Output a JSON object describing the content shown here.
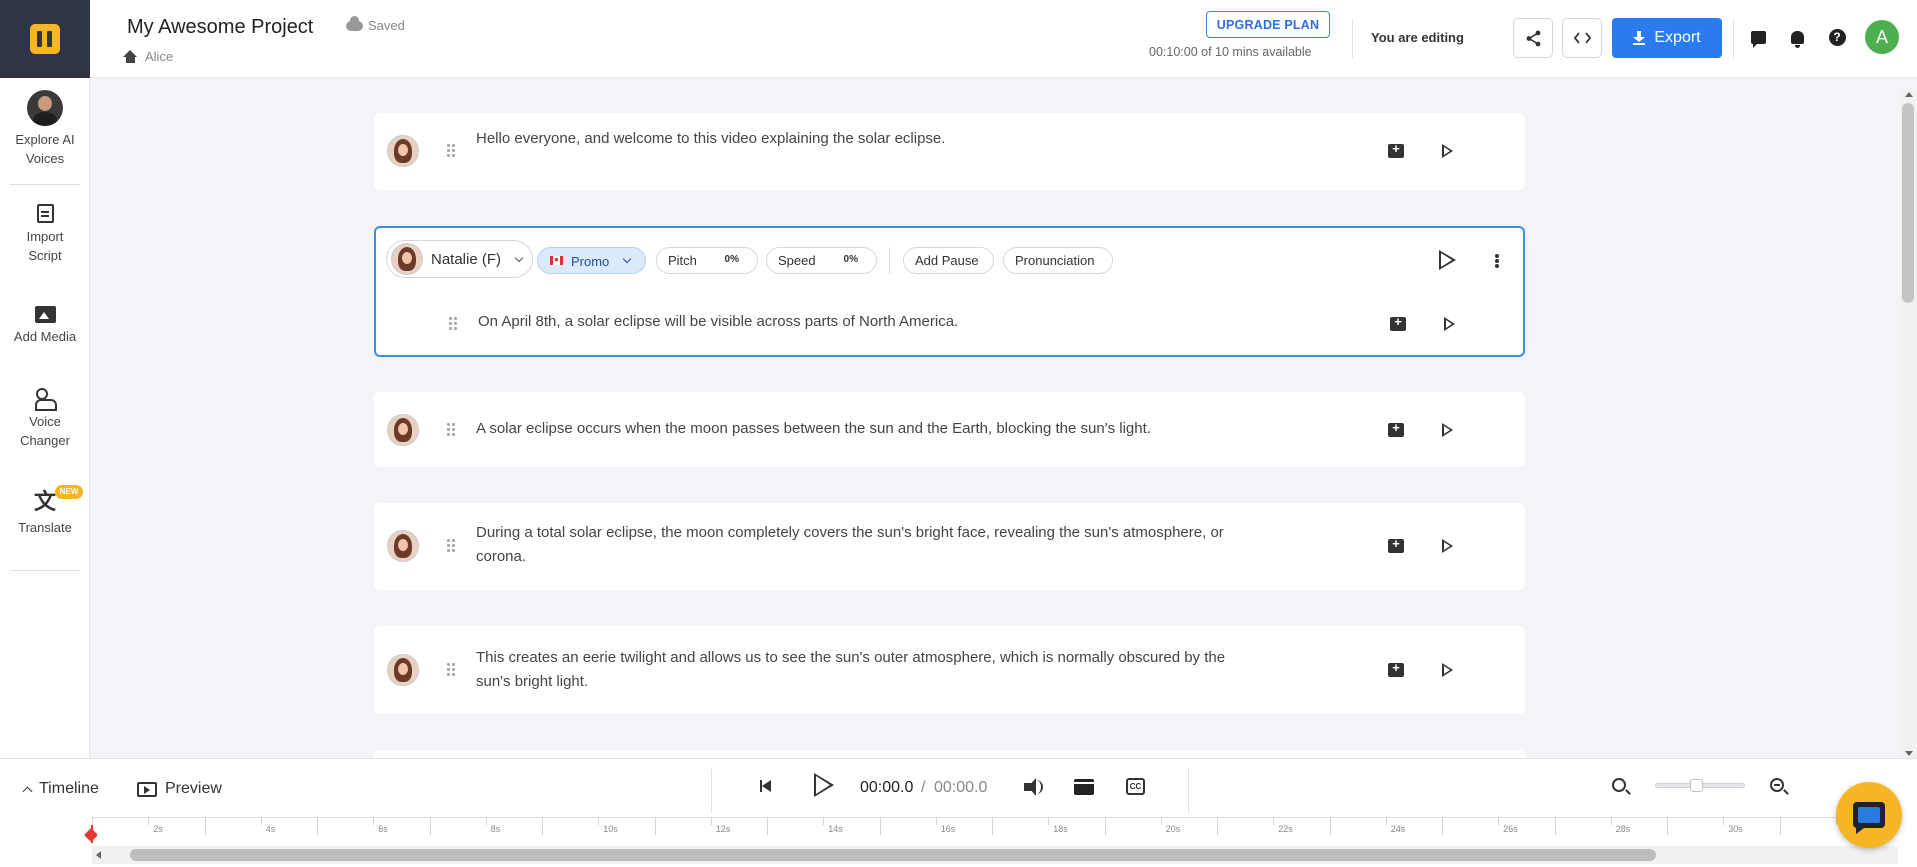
{
  "header": {
    "project_title": "My Awesome Project",
    "save_status": "Saved",
    "breadcrumb_user": "Alice",
    "upgrade_label": "UPGRADE PLAN",
    "minutes_available": "00:10:00 of 10 mins available",
    "editing_status": "You are editing",
    "export_label": "Export",
    "user_initial": "A",
    "user_avatar_color": "#4caf50",
    "accent_color": "#2b7bf0",
    "icons": [
      "share-icon",
      "embed-code-icon",
      "download-icon",
      "chat-icon",
      "bell-icon",
      "help-icon"
    ]
  },
  "sidebar": {
    "items": [
      {
        "label_line1": "Explore AI",
        "label_line2": "Voices",
        "icon": "voice-avatar-icon"
      },
      {
        "label_line1": "Import",
        "label_line2": "Script",
        "icon": "import-script-icon"
      },
      {
        "label_line1": "Add Media",
        "label_line2": "",
        "icon": "media-icon"
      },
      {
        "label_line1": "Voice",
        "label_line2": "Changer",
        "icon": "voice-changer-icon"
      },
      {
        "label_line1": "Translate",
        "label_line2": "",
        "icon": "translate-icon",
        "badge": "NEW"
      }
    ]
  },
  "blocks": [
    {
      "text": "Hello everyone, and welcome to this video explaining the solar eclipse."
    },
    {
      "text": "On April 8th, a solar eclipse will be visible across parts of North America.",
      "active": true
    },
    {
      "text": "A solar eclipse occurs when the moon passes between the sun and the Earth, blocking the sun's light."
    },
    {
      "text_line1": "During a total solar eclipse, the moon completely covers the sun's bright face, revealing the sun's atmosphere, or",
      "text_line2": "corona."
    },
    {
      "text_line1": "This creates an eerie twilight and allows us to see the sun's outer atmosphere, which is normally obscured by the",
      "text_line2": "sun's bright light."
    }
  ],
  "active_block": {
    "voice_name": "Natalie (F)",
    "style_label": "Promo",
    "pitch_label": "Pitch",
    "pitch_value": "0%",
    "speed_label": "Speed",
    "speed_value": "0%",
    "add_pause_label": "Add Pause",
    "pronunciation_label": "Pronunciation",
    "highlight_color": "#3c8ee0"
  },
  "bottom": {
    "timeline_label": "Timeline",
    "preview_label": "Preview",
    "current_time": "00:00.0",
    "separator": "/",
    "total_time": "00:00.0",
    "cc_label": "CC",
    "zoom_level": 0.45,
    "ruler_ticks": [
      "2s",
      "4s",
      "6s",
      "8s",
      "10s",
      "12s",
      "14s",
      "16s",
      "18s",
      "20s",
      "22s",
      "24s",
      "26s",
      "28s",
      "30s"
    ]
  }
}
